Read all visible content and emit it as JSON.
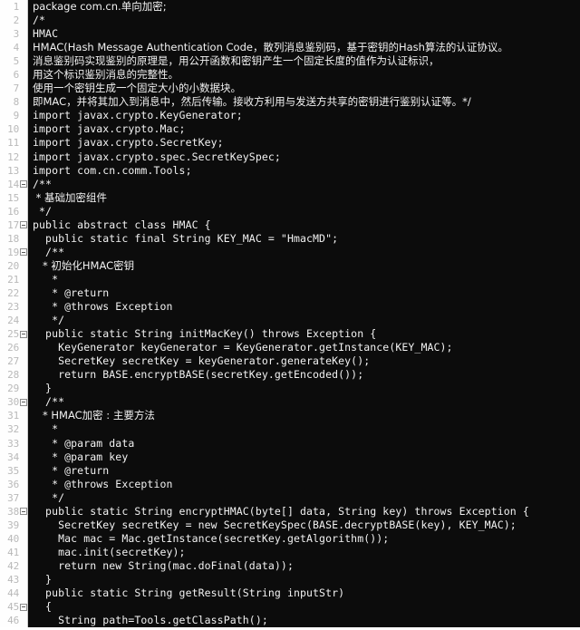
{
  "editor": {
    "name": "code-editor",
    "language": "Java",
    "theme": {
      "gutter_bg": "#fefefe",
      "gutter_fg": "#b9b9b9",
      "code_bg": "#0c0c0c",
      "code_fg": "#f2f2f2",
      "separator": "#cfcfcf"
    },
    "first_visible_line": 1,
    "last_visible_line": 46,
    "fold_marker_glyph": "minus-box",
    "folded_lines": [
      14,
      17,
      19,
      25,
      30,
      38,
      45
    ],
    "lines": [
      {
        "n": 1,
        "text": "package com.cn.单向加密;",
        "fold": false,
        "cjk": true
      },
      {
        "n": 2,
        "text": "/*",
        "fold": false,
        "cjk": false
      },
      {
        "n": 3,
        "text": "HMAC",
        "fold": false,
        "cjk": false
      },
      {
        "n": 4,
        "text": "HMAC(Hash Message Authentication Code，散列消息鉴别码，基于密钥的Hash算法的认证协议。",
        "fold": false,
        "cjk": true
      },
      {
        "n": 5,
        "text": "消息鉴别码实现鉴别的原理是，用公开函数和密钥产生一个固定长度的值作为认证标识，",
        "fold": false,
        "cjk": true
      },
      {
        "n": 6,
        "text": "用这个标识鉴别消息的完整性。",
        "fold": false,
        "cjk": true
      },
      {
        "n": 7,
        "text": "使用一个密钥生成一个固定大小的小数据块。",
        "fold": false,
        "cjk": true
      },
      {
        "n": 8,
        "text": "即MAC，并将其加入到消息中，然后传输。接收方利用与发送方共享的密钥进行鉴别认证等。*/",
        "fold": false,
        "cjk": true
      },
      {
        "n": 9,
        "text": "import javax.crypto.KeyGenerator;",
        "fold": false,
        "cjk": false
      },
      {
        "n": 10,
        "text": "import javax.crypto.Mac;",
        "fold": false,
        "cjk": false
      },
      {
        "n": 11,
        "text": "import javax.crypto.SecretKey;",
        "fold": false,
        "cjk": false
      },
      {
        "n": 12,
        "text": "import javax.crypto.spec.SecretKeySpec;",
        "fold": false,
        "cjk": false
      },
      {
        "n": 13,
        "text": "import com.cn.comm.Tools;",
        "fold": false,
        "cjk": false
      },
      {
        "n": 14,
        "text": "/**",
        "fold": true,
        "cjk": false
      },
      {
        "n": 15,
        "text": " * 基础加密组件",
        "fold": false,
        "cjk": true
      },
      {
        "n": 16,
        "text": " */",
        "fold": false,
        "cjk": false
      },
      {
        "n": 17,
        "text": "public abstract class HMAC {",
        "fold": true,
        "cjk": false
      },
      {
        "n": 18,
        "text": "  public static final String KEY_MAC = \"HmacMD\";",
        "fold": false,
        "cjk": false
      },
      {
        "n": 19,
        "text": "  /**",
        "fold": true,
        "cjk": false
      },
      {
        "n": 20,
        "text": "   * 初始化HMAC密钥",
        "fold": false,
        "cjk": true
      },
      {
        "n": 21,
        "text": "   *",
        "fold": false,
        "cjk": false
      },
      {
        "n": 22,
        "text": "   * @return",
        "fold": false,
        "cjk": false
      },
      {
        "n": 23,
        "text": "   * @throws Exception",
        "fold": false,
        "cjk": false
      },
      {
        "n": 24,
        "text": "   */",
        "fold": false,
        "cjk": false
      },
      {
        "n": 25,
        "text": "  public static String initMacKey() throws Exception {",
        "fold": true,
        "cjk": false
      },
      {
        "n": 26,
        "text": "    KeyGenerator keyGenerator = KeyGenerator.getInstance(KEY_MAC);",
        "fold": false,
        "cjk": false
      },
      {
        "n": 27,
        "text": "    SecretKey secretKey = keyGenerator.generateKey();",
        "fold": false,
        "cjk": false
      },
      {
        "n": 28,
        "text": "    return BASE.encryptBASE(secretKey.getEncoded());",
        "fold": false,
        "cjk": false
      },
      {
        "n": 29,
        "text": "  }",
        "fold": false,
        "cjk": false
      },
      {
        "n": 30,
        "text": "  /**",
        "fold": true,
        "cjk": false
      },
      {
        "n": 31,
        "text": "   * HMAC加密 : 主要方法",
        "fold": false,
        "cjk": true
      },
      {
        "n": 32,
        "text": "   *",
        "fold": false,
        "cjk": false
      },
      {
        "n": 33,
        "text": "   * @param data",
        "fold": false,
        "cjk": false
      },
      {
        "n": 34,
        "text": "   * @param key",
        "fold": false,
        "cjk": false
      },
      {
        "n": 35,
        "text": "   * @return",
        "fold": false,
        "cjk": false
      },
      {
        "n": 36,
        "text": "   * @throws Exception",
        "fold": false,
        "cjk": false
      },
      {
        "n": 37,
        "text": "   */",
        "fold": false,
        "cjk": false
      },
      {
        "n": 38,
        "text": "  public static String encryptHMAC(byte[] data, String key) throws Exception {",
        "fold": true,
        "cjk": false
      },
      {
        "n": 39,
        "text": "    SecretKey secretKey = new SecretKeySpec(BASE.decryptBASE(key), KEY_MAC);",
        "fold": false,
        "cjk": false
      },
      {
        "n": 40,
        "text": "    Mac mac = Mac.getInstance(secretKey.getAlgorithm());",
        "fold": false,
        "cjk": false
      },
      {
        "n": 41,
        "text": "    mac.init(secretKey);",
        "fold": false,
        "cjk": false
      },
      {
        "n": 42,
        "text": "    return new String(mac.doFinal(data));",
        "fold": false,
        "cjk": false
      },
      {
        "n": 43,
        "text": "  }",
        "fold": false,
        "cjk": false
      },
      {
        "n": 44,
        "text": "  public static String getResult(String inputStr)",
        "fold": false,
        "cjk": false
      },
      {
        "n": 45,
        "text": "  {",
        "fold": true,
        "cjk": false
      },
      {
        "n": 46,
        "text": "    String path=Tools.getClassPath();",
        "fold": false,
        "cjk": false
      }
    ]
  }
}
